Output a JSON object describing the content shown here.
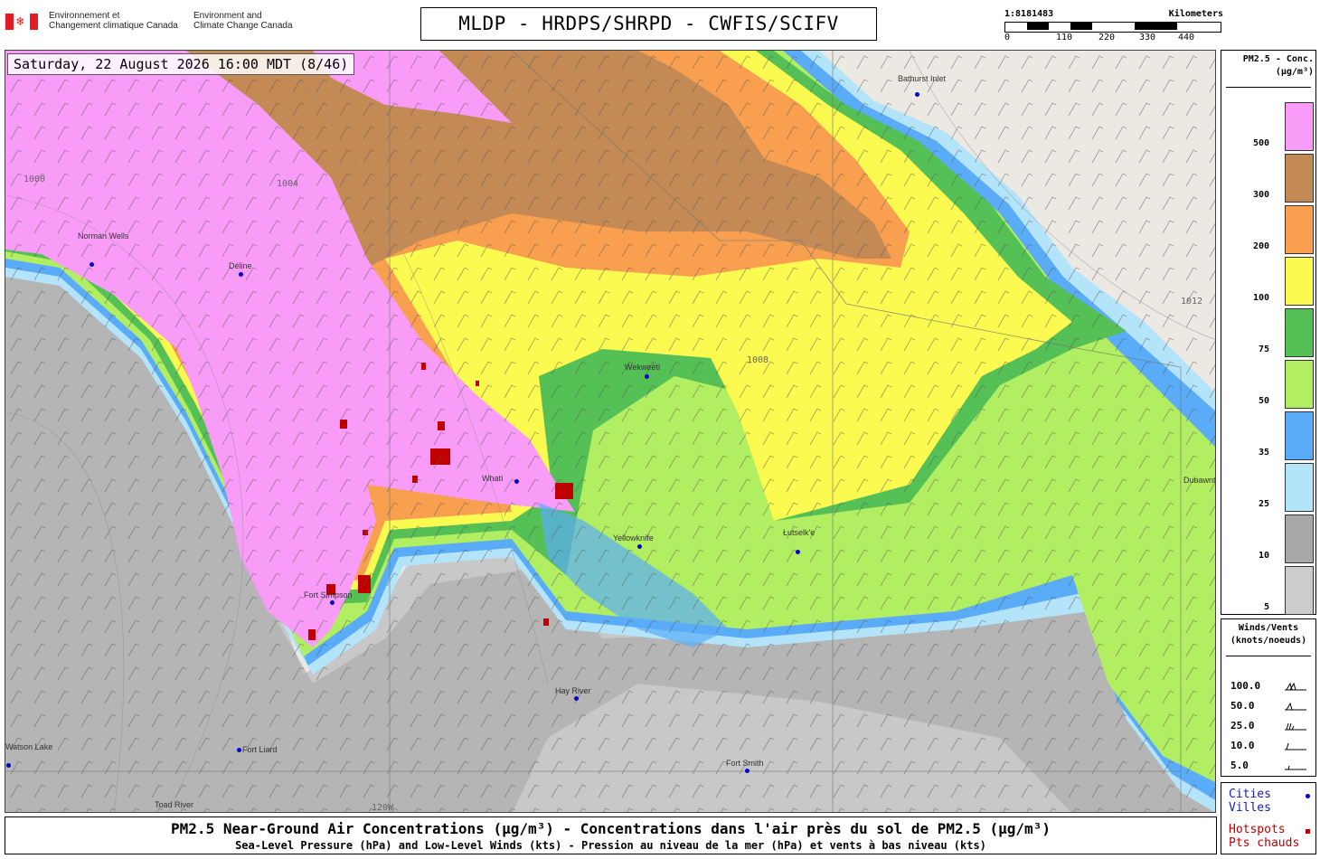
{
  "header": {
    "gov_fr": "Environnement et\nChangement climatique Canada",
    "gov_en": "Environment and\nClimate Change Canada",
    "title": "MLDP - HRDPS/SHRPD - CWFIS/SCIFV"
  },
  "scale": {
    "ratio": "1:8181483",
    "unit": "Kilometers",
    "ticks": [
      "0",
      "110",
      "220",
      "330",
      "440"
    ]
  },
  "map": {
    "timestamp": "Saturday, 22 August 2026 16:00 MDT (8/46)",
    "cities": [
      {
        "name": "Bathurst Inlet"
      },
      {
        "name": "Norman Wells"
      },
      {
        "name": "Déline"
      },
      {
        "name": "Wekweètì"
      },
      {
        "name": "Whatì"
      },
      {
        "name": "Yellowknife"
      },
      {
        "name": "Łutselk'e"
      },
      {
        "name": "Fort Simpson"
      },
      {
        "name": "Hay River"
      },
      {
        "name": "Fort Liard"
      },
      {
        "name": "Fort Smith"
      },
      {
        "name": "Toad River"
      },
      {
        "name": "Watson Lake"
      },
      {
        "name": "Dubawnt Lake"
      }
    ],
    "isobars": [
      "1000",
      "1004",
      "1008",
      "1012"
    ],
    "meridian": "120W"
  },
  "legend_pm": {
    "title": "PM2.5 - Conc.\n(µg/m³)",
    "levels": [
      {
        "label": "500",
        "color": "#f89cf8"
      },
      {
        "label": "300",
        "color": "#c48a55"
      },
      {
        "label": "200",
        "color": "#f8a050"
      },
      {
        "label": "100",
        "color": "#fafa50"
      },
      {
        "label": "75",
        "color": "#55c055"
      },
      {
        "label": "50",
        "color": "#b2ee62"
      },
      {
        "label": "35",
        "color": "#5aacf8"
      },
      {
        "label": "25",
        "color": "#b4e4fa"
      },
      {
        "label": "10",
        "color": "#a8a8a8"
      },
      {
        "label": "5",
        "color": "#cccccc"
      }
    ]
  },
  "legend_wind": {
    "title": "Winds/Vents\n(knots/noeuds)",
    "speeds": [
      "100.0",
      "50.0",
      "25.0",
      "10.0",
      "5.0"
    ]
  },
  "legend_points": {
    "cities_en": "Cities",
    "cities_fr": "Villes",
    "hotspots_en": "Hotspots",
    "hotspots_fr": "Pts chauds"
  },
  "caption": {
    "line1": "PM2.5 Near-Ground Air Concentrations (µg/m³) - Concentrations dans l'air près du sol de PM2.5 (µg/m³)",
    "line2": "Sea-Level Pressure (hPa) and Low-Level Winds (kts) - Pression au niveau de la mer (hPa) et vents à bas niveau (kts)"
  }
}
